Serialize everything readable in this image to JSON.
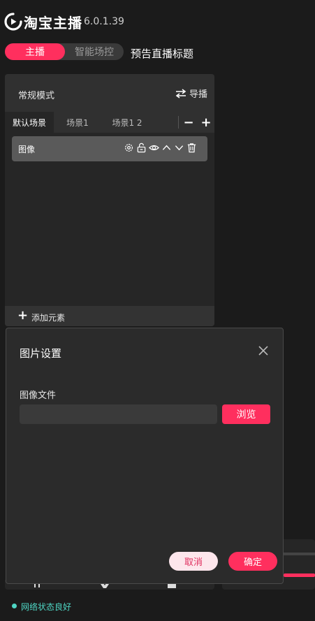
{
  "app": {
    "title": "淘宝主播",
    "version": "6.0.1.39"
  },
  "mode_tabs": {
    "anchor": "主播",
    "smart": "智能场控"
  },
  "live_title": "预告直播标题",
  "scene_panel": {
    "mode_label": "常规模式",
    "guide_label": "导播",
    "tabs": [
      "默认场景",
      "场景1",
      "场景1 2"
    ],
    "minus_label": "−",
    "plus_label": "+",
    "element": {
      "label": "图像",
      "action_icons": [
        "gear-icon",
        "unlock-icon",
        "eye-icon",
        "chevron-up-icon",
        "chevron-down-icon",
        "trash-icon"
      ]
    },
    "add_element_plus": "+",
    "add_element_label": "添加元素"
  },
  "dialog": {
    "title": "图片设置",
    "file_label": "图像文件",
    "file_value": "",
    "browse_label": "浏览",
    "cancel_label": "取消",
    "confirm_label": "确定"
  },
  "status": {
    "text": "网络状态良好"
  },
  "colors": {
    "accent": "#ff2f5e",
    "background": "#1b1b1b",
    "panel": "#262626",
    "status_ok": "#4fd6c4",
    "cancel_bg": "#fde6ec"
  }
}
